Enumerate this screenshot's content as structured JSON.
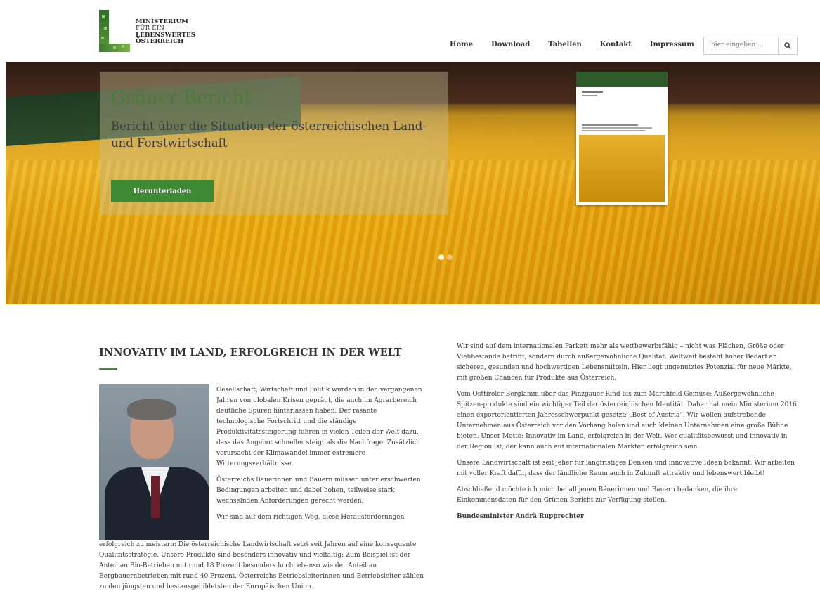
{
  "logo": {
    "line1": "MINISTERIUM",
    "line2": "FÜR EIN",
    "line3": "LEBENSWERTES",
    "line4": "ÖSTERREICH"
  },
  "nav": {
    "items": [
      "Home",
      "Download",
      "Tabellen",
      "Kontakt",
      "Impressum"
    ]
  },
  "search": {
    "placeholder": "hier eingeben ...",
    "icon": "search-icon"
  },
  "hero": {
    "title": "Grüner Bericht",
    "subtitle": "Bericht über die Situation der österreichischen Land- und Forstwirtschaft",
    "button_label": "Herunterladen",
    "slides": 2,
    "active_slide": 1
  },
  "article": {
    "heading": "INNOVATIV IM LAND, ERFOLGREICH IN DER WELT",
    "left_paragraphs": [
      "Gesellschaft, Wirtschaft und Politik wurden in den vergangenen Jahren von globalen Krisen geprägt, die auch im Agrarbereich deutliche Spuren hinterlassen haben. Der rasante technologische Fortschritt und die ständige Produktivitätssteigerung führen in vielen Teilen der Welt dazu, dass das Angebot schneller steigt als die Nachfrage. Zusätzlich verursacht der Klimawandel immer extremere Witterungsverhältnisse.",
      "Österreichs Bäuerinnen und Bauern müssen unter erschwerten Bedingungen arbeiten und dabei hohen, teilweise stark wechselnden Anforderungen gerecht werden.",
      "Wir sind auf dem richtigen Weg, diese Herausforderungen"
    ],
    "left_full_paragraph": "erfolgreich zu meistern: Die österreichische Landwirtschaft setzt seit Jahren auf eine konsequente Qualitätsstrategie. Unsere Produkte sind besonders innovativ und vielfältig: Zum Beispiel ist der Anteil an Bio-Betrieben mit rund 18 Prozent besonders hoch, ebenso wie der Anteil an Bergbauernbetrieben mit rund 40 Prozent. Österreichs Betriebsleiterinnen und Betriebsleiter zählen zu den jüngsten und bestausgebildetsten der Europäischen Union.",
    "right_paragraphs": [
      "Wir sind auf dem internationalen Parkett mehr als wettbewerbsfähig – nicht was Flächen, Größe oder Viehbestände betrifft, sondern durch außergewöhnliche Qualität. Weltweit besteht hoher Bedarf an sicheren, gesunden und hochwertigen Lebensmitteln. Hier liegt ungenutztes Potenzial für neue Märkte, mit großen Chancen für Produkte aus Österreich.",
      "Vom Osttiroler Berglamm über das Pinzgauer Rind bis zum Marchfeld Gemüse: Außergewöhnliche Spitzen-produkte sind ein wichtiger Teil der österreichischen Identität. Daher hat mein Ministerium 2016 einen exportorientierten Jahresschwerpunkt gesetzt: „Best of Austria“. Wir wollen aufstrebende Unternehmen aus Österreich vor den Vorhang holen und auch kleinen Unternehmen eine große Bühne bieten. Unser Motto: Innovativ im Land, erfolgreich in der Welt. Wer qualitätsbewusst und innovativ in der Region ist, der kann auch auf internationalen Märkten erfolgreich sein.",
      "Unsere Landwirtschaft ist seit jeher für langfristiges Denken und innovative Ideen bekannt. Wir arbeiten mit voller Kraft dafür, dass der ländliche Raum auch in Zukunft attraktiv und lebenswert bleibt!",
      "Abschließend möchte ich mich bei all jenen Bäuerinnen und Bauern bedanken, die ihre Einkommensdaten für den Grünen Bericht zur Verfügung stellen."
    ],
    "signature": "Bundesminister Andrä Rupprechter"
  },
  "colors": {
    "accent_green": "#3f8a35",
    "title_green": "#4b7a3a",
    "text": "#3a3a3a"
  }
}
